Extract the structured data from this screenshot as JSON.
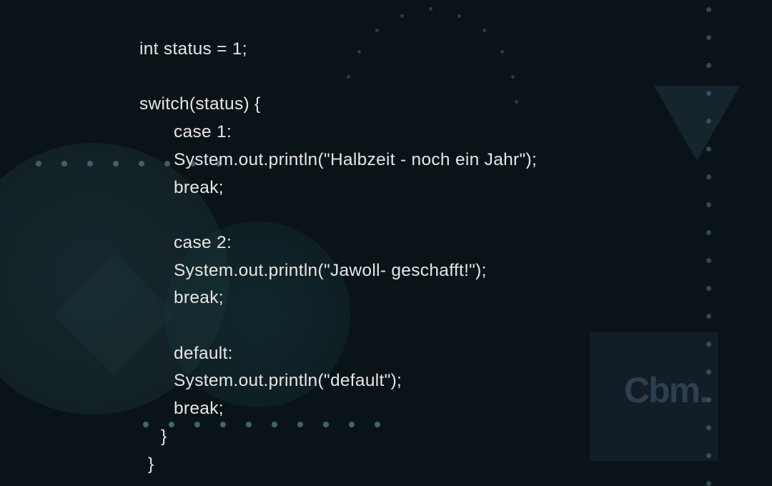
{
  "code": {
    "line1": "int status = 1;",
    "line2": "",
    "line3": "switch(status) {",
    "line4": "case 1:",
    "line5": "System.out.println(\"Halbzeit - noch ein Jahr\");",
    "line6": "break;",
    "line7": "",
    "line8": "case 2:",
    "line9": "System.out.println(\"Jawoll- geschafft!\");",
    "line10": "break;",
    "line11": "",
    "line12": "default:",
    "line13": "System.out.println(\"default\");",
    "line14": "break;",
    "line15": "}",
    "line16": "}"
  },
  "logo": {
    "text": "Cbm",
    "suffix": "."
  }
}
